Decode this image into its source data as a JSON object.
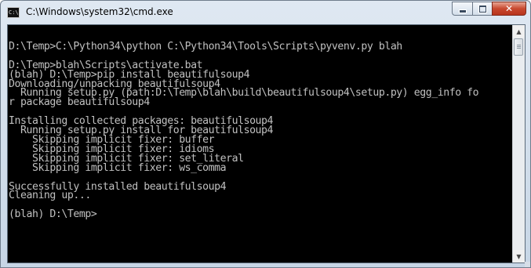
{
  "window": {
    "title": "C:\\Windows\\system32\\cmd.exe",
    "icon_text": "C:\\",
    "minimize_icon": "minimize-icon",
    "maximize_icon": "maximize-icon",
    "close_icon": "close-icon",
    "close_glyph": "✕"
  },
  "console": {
    "lines": [
      "",
      "D:\\Temp>C:\\Python34\\python C:\\Python34\\Tools\\Scripts\\pyvenv.py blah",
      "",
      "D:\\Temp>blah\\Scripts\\activate.bat",
      "(blah) D:\\Temp>pip install beautifulsoup4",
      "Downloading/unpacking beautifulsoup4",
      "  Running setup.py (path:D:\\Temp\\blah\\build\\beautifulsoup4\\setup.py) egg_info fo",
      "r package beautifulsoup4",
      "",
      "Installing collected packages: beautifulsoup4",
      "  Running setup.py install for beautifulsoup4",
      "    Skipping implicit fixer: buffer",
      "    Skipping implicit fixer: idioms",
      "    Skipping implicit fixer: set_literal",
      "    Skipping implicit fixer: ws_comma",
      "",
      "Successfully installed beautifulsoup4",
      "Cleaning up...",
      "",
      "(blah) D:\\Temp>"
    ]
  },
  "scrollbar": {
    "up_arrow": "▲",
    "down_arrow": "▼"
  }
}
